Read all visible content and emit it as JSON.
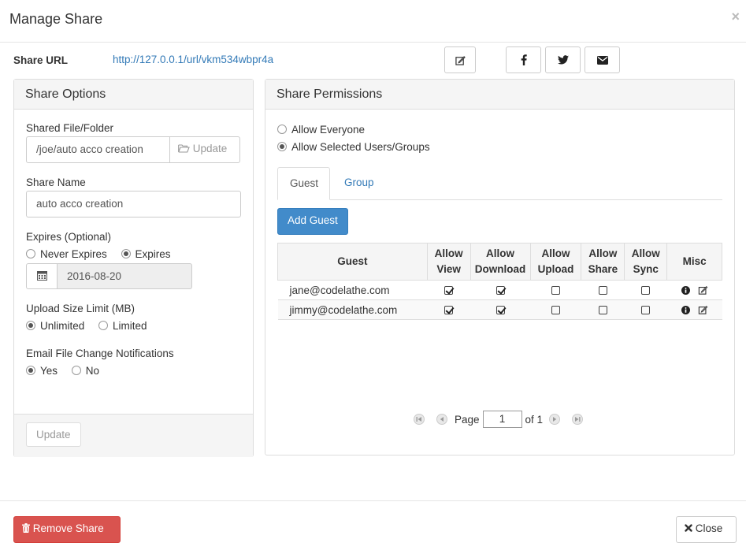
{
  "dialog": {
    "title": "Manage Share",
    "close_symbol": "×"
  },
  "share_url": {
    "label": "Share URL",
    "value": "http://127.0.0.1/url/vkm534wbpr4a",
    "buttons": [
      "edit-icon",
      "facebook-icon",
      "twitter-icon",
      "email-icon"
    ]
  },
  "share_options": {
    "heading": "Share Options",
    "shared_file": {
      "label": "Shared File/Folder",
      "value": "/joe/auto acco creation",
      "update_label": "Update"
    },
    "share_name": {
      "label": "Share Name",
      "value": "auto acco creation"
    },
    "expires": {
      "label": "Expires (Optional)",
      "options": [
        "Never Expires",
        "Expires"
      ],
      "selected": "Expires",
      "date": "2016-08-20"
    },
    "upload_limit": {
      "label": "Upload Size Limit (MB)",
      "options": [
        "Unlimited",
        "Limited"
      ],
      "selected": "Unlimited"
    },
    "notifications": {
      "label": "Email File Change Notifications",
      "options": [
        "Yes",
        "No"
      ],
      "selected": "Yes"
    },
    "update_button": "Update"
  },
  "share_permissions": {
    "heading": "Share Permissions",
    "access_options": [
      "Allow Everyone",
      "Allow Selected Users/Groups"
    ],
    "selected_access": "Allow Selected Users/Groups",
    "tabs": [
      {
        "label": "Guest",
        "active": true
      },
      {
        "label": "Group",
        "active": false
      }
    ],
    "add_guest_label": "Add Guest",
    "table": {
      "headers": [
        "Guest",
        "Allow View",
        "Allow Download",
        "Allow Upload",
        "Allow Share",
        "Allow Sync",
        "Misc"
      ],
      "rows": [
        {
          "guest": "jane@codelathe.com",
          "view": true,
          "download": true,
          "upload": false,
          "share": false,
          "sync": false
        },
        {
          "guest": "jimmy@codelathe.com",
          "view": true,
          "download": true,
          "upload": false,
          "share": false,
          "sync": false
        }
      ]
    },
    "pager": {
      "page_label": "Page",
      "page_value": "1",
      "of_label": "of 1"
    }
  },
  "footer": {
    "remove_label": "Remove Share",
    "close_label": "Close"
  },
  "colors": {
    "link": "#337ab7",
    "primary": "#428bca",
    "danger": "#d9534f"
  }
}
